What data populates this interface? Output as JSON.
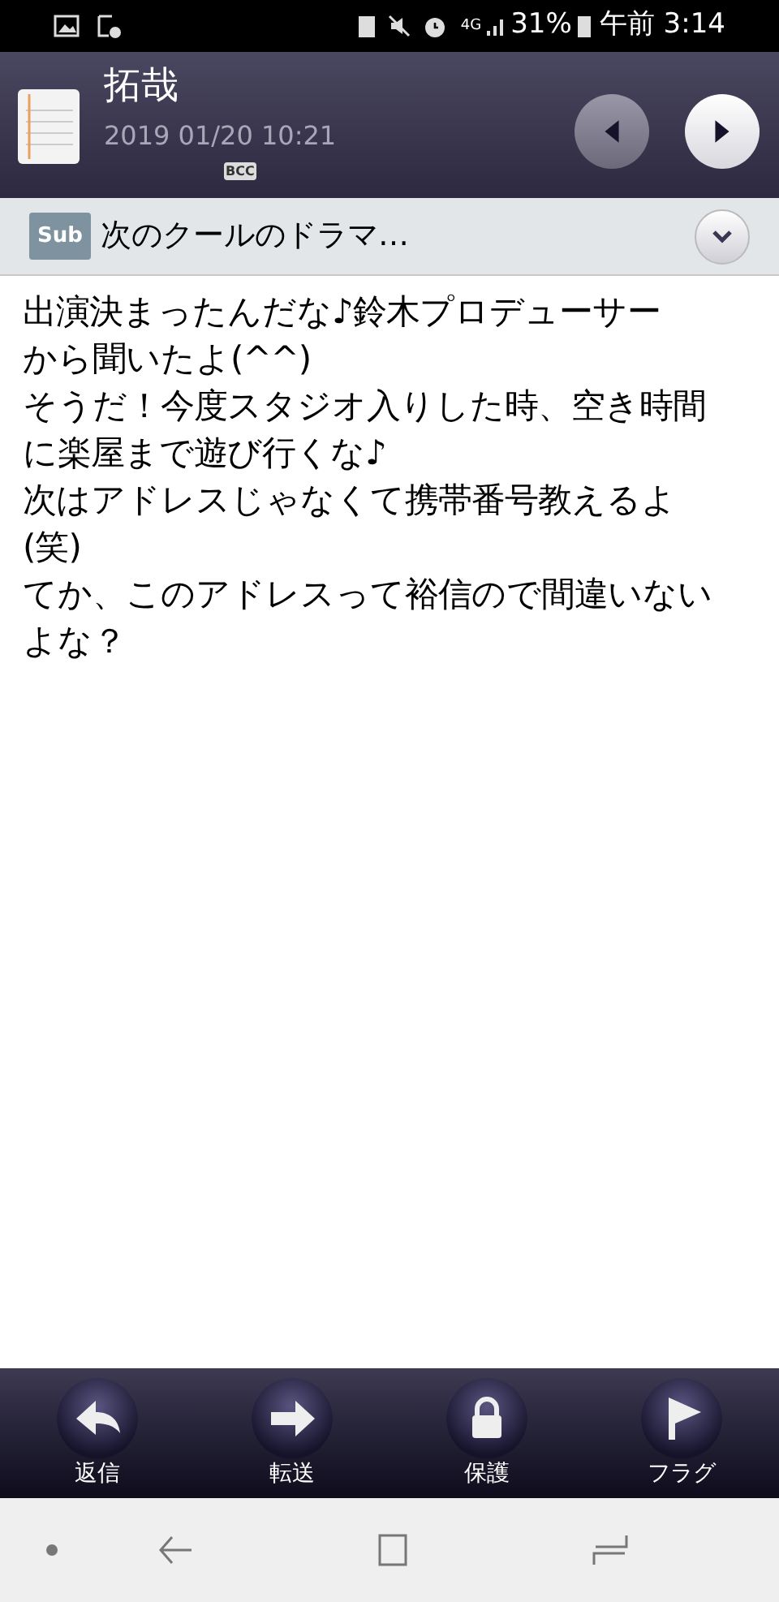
{
  "status_bar": {
    "network": "4G",
    "battery": "31%",
    "time": "午前 3:14"
  },
  "header": {
    "sender": "拓哉",
    "date": "2019 01/20 10:21",
    "bcc": "BCC"
  },
  "subject": {
    "tag": "Sub",
    "text": "次のクールのドラマ…",
    "expanded": false
  },
  "body_lines": [
    "出演決まったんだな♪鈴木プロデューサー",
    "から聞いたよ(^^)",
    "そうだ！今度スタジオ入りした時、空き時間",
    "に楽屋まで遊び行くな♪",
    "次はアドレスじゃなくて携帯番号教えるよ",
    "(笑)",
    "てか、このアドレスって裕信ので間違いない",
    "よな？"
  ],
  "actions": [
    {
      "kind": "reply",
      "label": "返信"
    },
    {
      "kind": "forward",
      "label": "転送"
    },
    {
      "kind": "lock",
      "label": "保護"
    },
    {
      "kind": "flag",
      "label": "フラグ"
    }
  ]
}
